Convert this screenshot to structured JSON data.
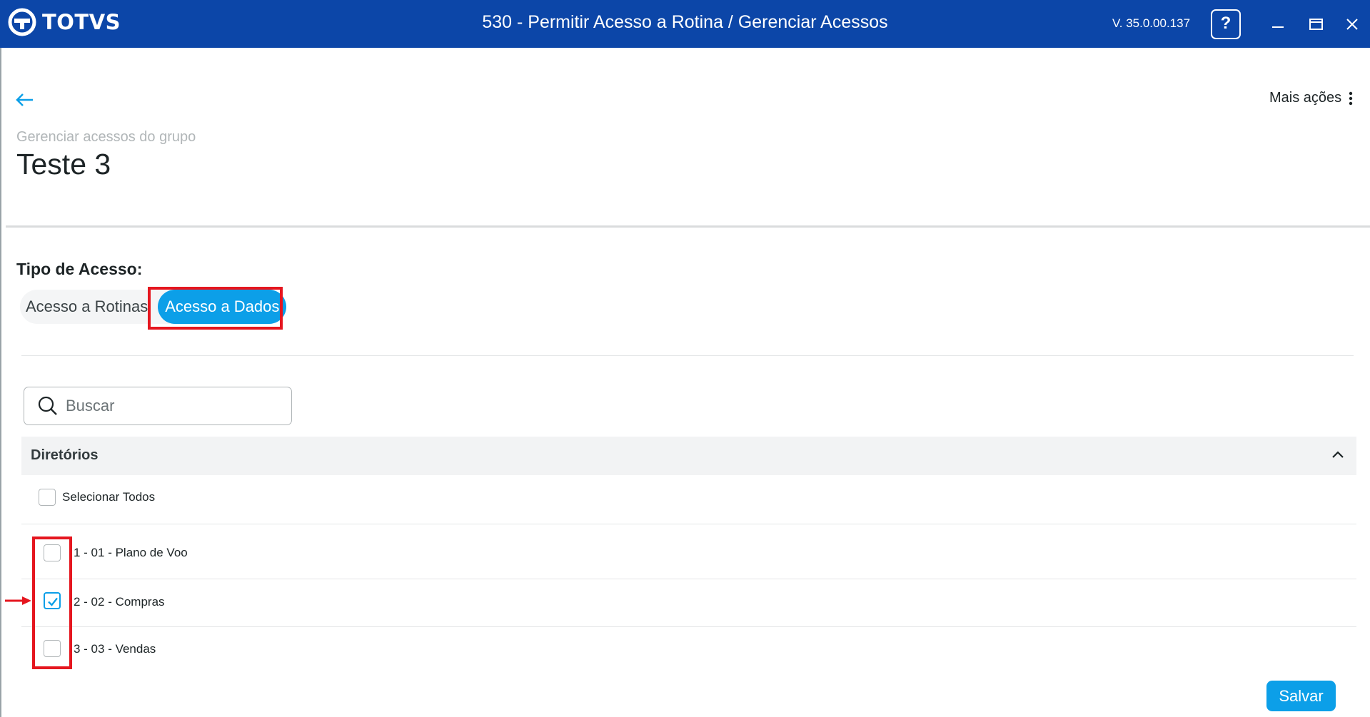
{
  "titlebar": {
    "brand": "TOTVS",
    "title": "530 - Permitir Acesso a Rotina / Gerenciar Acessos",
    "version": "V. 35.0.00.137",
    "help": "?",
    "bg_color": "#0c46a8"
  },
  "header": {
    "more_actions": "Mais ações",
    "subtitle": "Gerenciar acessos do grupo",
    "title": "Teste 3"
  },
  "access_type": {
    "label": "Tipo de Acesso:",
    "options": [
      "Acesso a Rotinas",
      "Acesso a Dados"
    ],
    "selected": "Acesso a Dados"
  },
  "search": {
    "placeholder": "Buscar",
    "value": ""
  },
  "directories": {
    "title": "Diretórios",
    "select_all": "Selecionar Todos",
    "items": [
      {
        "label": "1 - 01 - Plano de Voo",
        "checked": false
      },
      {
        "label": "2 - 02 - Compras",
        "checked": true
      },
      {
        "label": "3 - 03 - Vendas",
        "checked": false
      }
    ]
  },
  "actions": {
    "save": "Salvar"
  },
  "colors": {
    "accent": "#0c9fe8",
    "highlight": "#e5161f"
  }
}
